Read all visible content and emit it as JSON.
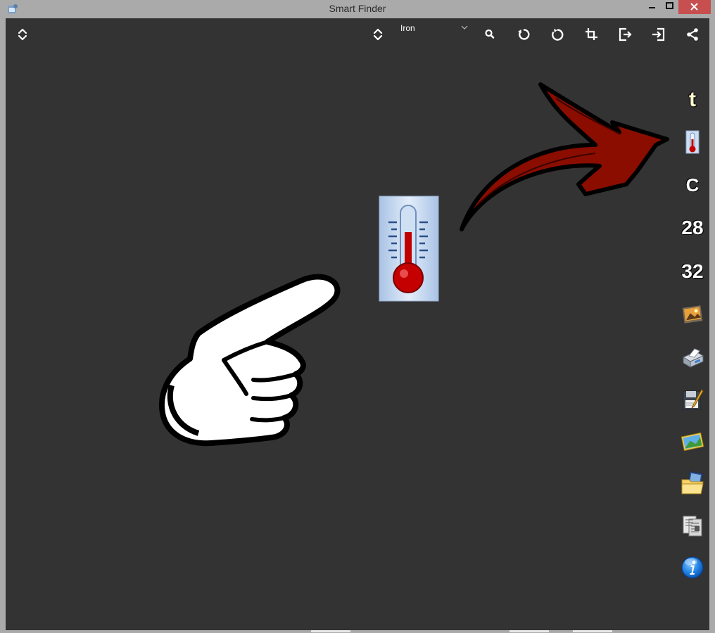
{
  "window": {
    "title": "Smart Finder"
  },
  "toolbar": {
    "mode_dropdown": {
      "selected": "Iron"
    },
    "icons": [
      "sort-arrows-icon",
      "sort-arrows-icon",
      "search-icon",
      "rotate-left-icon",
      "rotate-right-icon",
      "crop-icon",
      "logout-icon",
      "login-icon",
      "share-icon"
    ]
  },
  "sidebar": {
    "items": [
      {
        "label": "t",
        "icon": "letter-t-icon"
      },
      {
        "label": "",
        "icon": "thermometer-icon"
      },
      {
        "label": "C",
        "icon": "celsius-icon"
      },
      {
        "label": "28",
        "icon": "number-icon"
      },
      {
        "label": "32",
        "icon": "number-icon"
      },
      {
        "label": "",
        "icon": "picture-icon"
      },
      {
        "label": "",
        "icon": "printer-icon"
      },
      {
        "label": "",
        "icon": "save-edit-icon"
      },
      {
        "label": "",
        "icon": "image-gallery-icon"
      },
      {
        "label": "",
        "icon": "folder-images-icon"
      },
      {
        "label": "",
        "icon": "documents-icon"
      },
      {
        "label": "",
        "icon": "info-icon"
      }
    ]
  },
  "colors": {
    "canvas": "#333333",
    "frame": "#aaaaaa",
    "close_button": "#c74f4f",
    "arrow": "#8b0d00",
    "thermometer_red": "#c00000"
  }
}
